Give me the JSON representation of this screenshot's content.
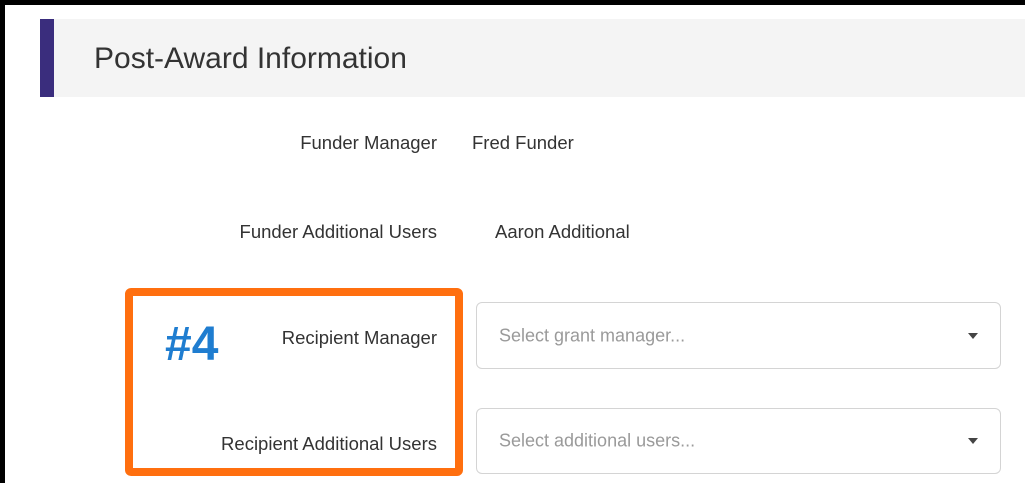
{
  "section": {
    "title": "Post-Award Information"
  },
  "fields": {
    "funder_manager": {
      "label": "Funder Manager",
      "value": "Fred Funder"
    },
    "funder_additional_users": {
      "label": "Funder Additional Users",
      "value": "Aaron Additional"
    },
    "recipient_manager": {
      "label": "Recipient Manager",
      "placeholder": "Select grant manager..."
    },
    "recipient_additional_users": {
      "label": "Recipient Additional Users",
      "placeholder": "Select additional users..."
    }
  },
  "annotation": {
    "step": "#4",
    "highlight_color": "#ff6f0f",
    "step_color": "#1f7dd0"
  },
  "colors": {
    "accent": "#3a2d7d",
    "header_bg": "#f4f4f4",
    "text": "#333333",
    "placeholder": "#9a9a9a"
  },
  "icons": {
    "dropdown": "caret-down-icon"
  }
}
